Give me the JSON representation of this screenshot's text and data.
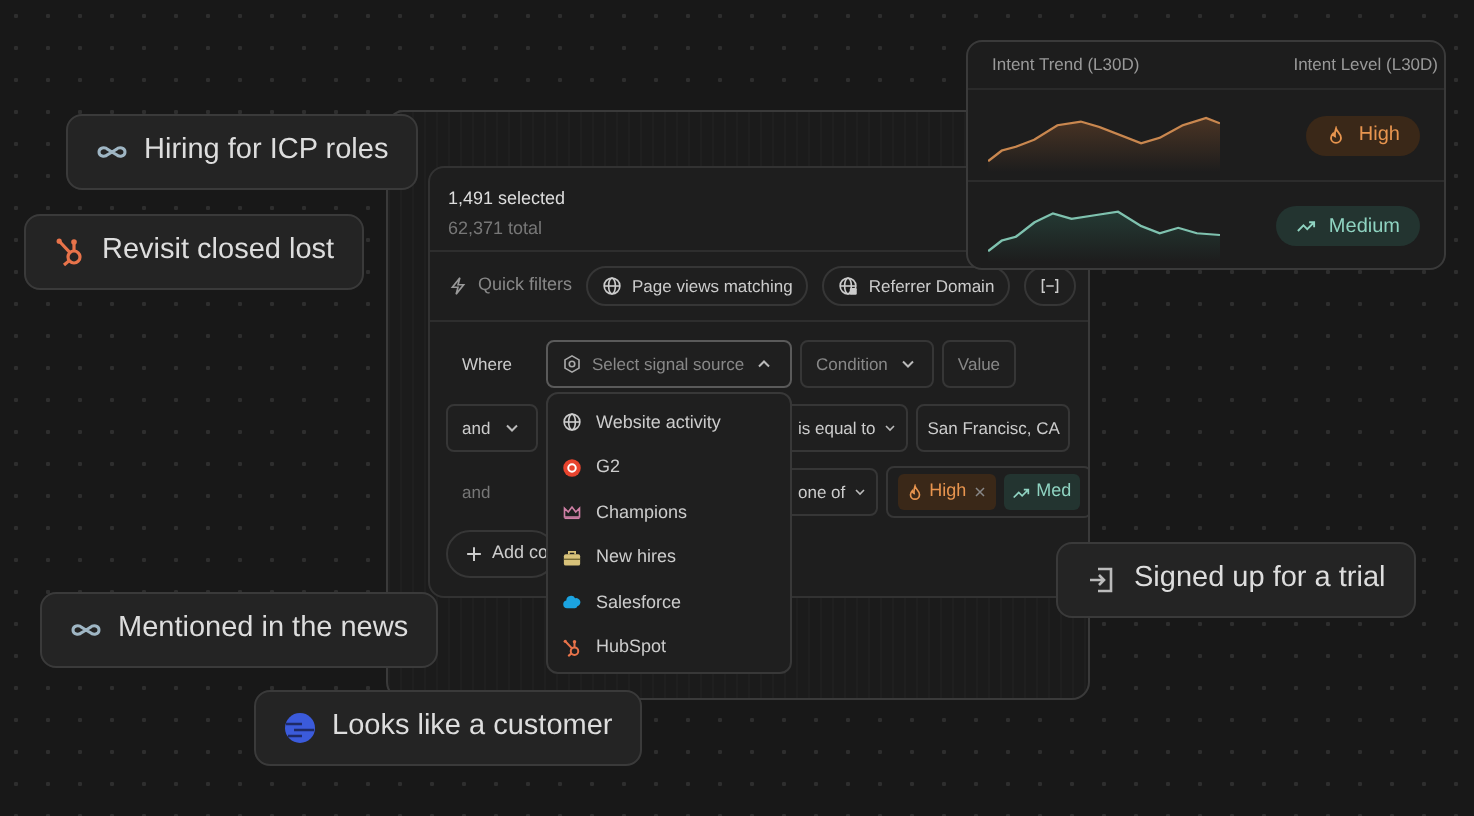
{
  "signals": [
    {
      "label": "Hiring for ICP roles",
      "kind": "infinity"
    },
    {
      "label": "Revisit closed lost",
      "kind": "hubspot"
    },
    {
      "label": "Mentioned in the news",
      "kind": "infinity"
    },
    {
      "label": "Looks like a customer",
      "kind": "lookalike"
    },
    {
      "label": "Signed up for a trial",
      "kind": "trial"
    }
  ],
  "results": {
    "selected": "1,491 selected",
    "total": "62,371 total"
  },
  "quick_filters": {
    "label": "Quick filters",
    "chips": [
      {
        "label": "Page views matching",
        "kind": "globe"
      },
      {
        "label": "Referrer Domain",
        "kind": "domain"
      },
      {
        "kind": "bracket"
      }
    ]
  },
  "filters": [
    {
      "conjunction": {
        "label": "Where",
        "kind": "text"
      },
      "source": {
        "placeholder": "Select signal source",
        "expanded": true
      },
      "condition": {
        "placeholder": "Condition"
      },
      "value": {
        "placeholder": "Value"
      }
    },
    {
      "conjunction": {
        "label": "and",
        "kind": "select"
      },
      "condition": {
        "value": "is equal to"
      },
      "value": {
        "value": "San Francisc, CA"
      }
    },
    {
      "conjunction": {
        "label": "and",
        "kind": "text"
      },
      "condition": {
        "value": "one of"
      },
      "tags": [
        {
          "label": "High",
          "kind": "high"
        },
        {
          "label": "Med",
          "kind": "medium"
        }
      ]
    }
  ],
  "add_condition": "Add co",
  "source_menu": [
    {
      "label": "Website activity",
      "kind": "globe"
    },
    {
      "label": "G2",
      "kind": "g2"
    },
    {
      "label": "Champions",
      "kind": "crown"
    },
    {
      "label": "New hires",
      "kind": "briefcase"
    },
    {
      "label": "Salesforce",
      "kind": "cloud"
    },
    {
      "label": "HubSpot",
      "kind": "hubspot"
    }
  ],
  "intent": {
    "columns": [
      "Intent Trend (L30D)",
      "Intent Level (L30D)"
    ],
    "rows": [
      {
        "badge": "High",
        "kind": "high"
      },
      {
        "badge": "Medium",
        "kind": "medium"
      }
    ]
  }
}
